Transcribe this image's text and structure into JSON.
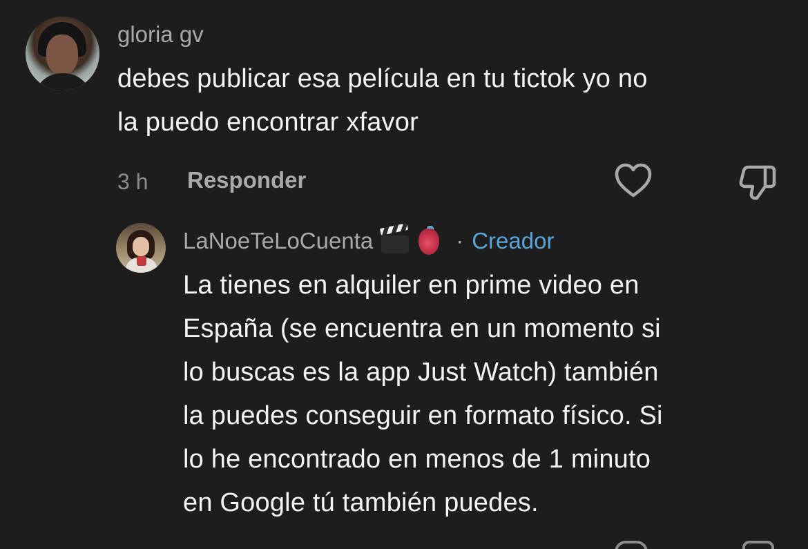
{
  "comments": [
    {
      "username": "gloria gv",
      "text_lines": [
        "debes publicar esa película en tu tictok yo no",
        "la puedo encontrar xfavor"
      ],
      "time": "3 h",
      "reply_label": "Responder",
      "like_icon": "heart-outline-icon",
      "dislike_icon": "thumbs-down-outline-icon"
    },
    {
      "username": "LaNoeTeLoCuenta",
      "emojis": [
        "clapper-board-emoji",
        "anatomical-heart-emoji"
      ],
      "separator": "·",
      "badge": "Creador",
      "text_lines": [
        "La tienes en alquiler en prime video en",
        "España (se encuentra en un momento si",
        "lo buscas es la app Just Watch) también",
        "la puedes conseguir en formato físico. Si",
        "lo he encontrado en menos de 1 minuto",
        "en Google tú también puedes."
      ]
    }
  ],
  "colors": {
    "background": "#1d1d1d",
    "text_primary": "#f4f4f4",
    "text_secondary": "#a9a9a9",
    "creator_badge": "#5aa5d9"
  }
}
